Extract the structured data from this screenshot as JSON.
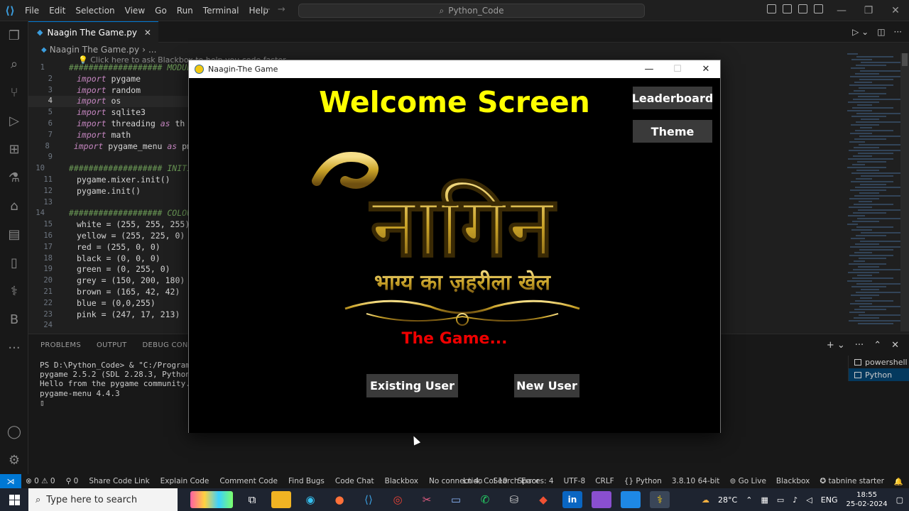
{
  "vscode": {
    "menu": [
      "File",
      "Edit",
      "Selection",
      "View",
      "Go",
      "Run",
      "Terminal",
      "Help"
    ],
    "search_label": "Python_Code",
    "tab_label": "Naagin The Game.py",
    "breadcrumb_file": "Naagin The Game.py",
    "breadcrumb_rest": "...",
    "codelens": "Click here to ask Blackbox to help you code faster",
    "code_lines": [
      {
        "n": "1",
        "parts": [
          {
            "t": "################### MODUL",
            "c": "cm"
          }
        ]
      },
      {
        "n": "2",
        "parts": [
          {
            "t": "import",
            "c": "kw"
          },
          {
            "t": " pygame",
            "c": ""
          }
        ]
      },
      {
        "n": "3",
        "parts": [
          {
            "t": "import",
            "c": "kw"
          },
          {
            "t": " random",
            "c": ""
          }
        ]
      },
      {
        "n": "4",
        "parts": [
          {
            "t": "import",
            "c": "kw"
          },
          {
            "t": " os",
            "c": ""
          }
        ]
      },
      {
        "n": "5",
        "parts": [
          {
            "t": "import",
            "c": "kw"
          },
          {
            "t": " sqlite3",
            "c": ""
          }
        ]
      },
      {
        "n": "6",
        "parts": [
          {
            "t": "import",
            "c": "kw"
          },
          {
            "t": " threading ",
            "c": ""
          },
          {
            "t": "as",
            "c": "kw"
          },
          {
            "t": " th",
            "c": ""
          }
        ]
      },
      {
        "n": "7",
        "parts": [
          {
            "t": "import",
            "c": "kw"
          },
          {
            "t": " math",
            "c": ""
          }
        ]
      },
      {
        "n": "8",
        "parts": [
          {
            "t": "import",
            "c": "kw"
          },
          {
            "t": " pygame_menu ",
            "c": ""
          },
          {
            "t": "as",
            "c": "kw"
          },
          {
            "t": " pm",
            "c": ""
          }
        ]
      },
      {
        "n": "9",
        "parts": [
          {
            "t": "",
            "c": ""
          }
        ]
      },
      {
        "n": "10",
        "parts": [
          {
            "t": "################### INITI",
            "c": "cm"
          }
        ]
      },
      {
        "n": "11",
        "parts": [
          {
            "t": "pygame.mixer.init()",
            "c": ""
          }
        ]
      },
      {
        "n": "12",
        "parts": [
          {
            "t": "pygame.init()",
            "c": ""
          }
        ]
      },
      {
        "n": "13",
        "parts": [
          {
            "t": "",
            "c": ""
          }
        ]
      },
      {
        "n": "14",
        "parts": [
          {
            "t": "################### COLOU",
            "c": "cm"
          }
        ]
      },
      {
        "n": "15",
        "parts": [
          {
            "t": "white = (255, 255, 255)",
            "c": ""
          }
        ]
      },
      {
        "n": "16",
        "parts": [
          {
            "t": "yellow = (255, 225, 0)",
            "c": ""
          }
        ]
      },
      {
        "n": "17",
        "parts": [
          {
            "t": "red = (255, 0, 0)",
            "c": ""
          }
        ]
      },
      {
        "n": "18",
        "parts": [
          {
            "t": "black = (0, 0, 0)",
            "c": ""
          }
        ]
      },
      {
        "n": "19",
        "parts": [
          {
            "t": "green = (0, 255, 0)",
            "c": ""
          }
        ]
      },
      {
        "n": "20",
        "parts": [
          {
            "t": "grey = (150, 200, 180)",
            "c": ""
          }
        ]
      },
      {
        "n": "21",
        "parts": [
          {
            "t": "brown = (165, 42, 42)",
            "c": ""
          }
        ]
      },
      {
        "n": "22",
        "parts": [
          {
            "t": "blue = (0,0,255)",
            "c": ""
          }
        ]
      },
      {
        "n": "23",
        "parts": [
          {
            "t": "pink = (247, 17, 213)",
            "c": ""
          }
        ]
      },
      {
        "n": "24",
        "parts": [
          {
            "t": "",
            "c": ""
          }
        ]
      }
    ],
    "active_line": "4",
    "panel_tabs": [
      "PROBLEMS",
      "OUTPUT",
      "DEBUG CONSOLE"
    ],
    "terminal_lines": [
      "PS D:\\Python_Code> & \"C:/Program Fi",
      "pygame 2.5.2 (SDL 2.28.3, Python 3.",
      "Hello from the pygame community. ht",
      "pygame-menu 4.4.3",
      "▯"
    ],
    "terminals": [
      "powershell",
      "Python"
    ],
    "status_left": [
      "⊗ 0 ⚠ 0",
      "⚲ 0",
      "Share Code Link",
      "Explain Code",
      "Comment Code",
      "Find Bugs",
      "Code Chat",
      "Blackbox",
      "No connection",
      "Search Error"
    ],
    "status_right": [
      "Ln 4, Col 10",
      "Spaces: 4",
      "UTF-8",
      "CRLF",
      "{} Python",
      "3.8.10 64-bit",
      "⊚ Go Live",
      "Blackbox",
      "✪ tabnine starter"
    ]
  },
  "game": {
    "window_title": "Naagin-The Game",
    "heading": "Welcome Screen",
    "leaderboard_label": "Leaderboard",
    "theme_label": "Theme",
    "logo_text": "नागिन",
    "logo_subtitle": "भाग्य का ज़हरीला खेल",
    "subtitle": "The Game...",
    "existing_user_label": "Existing User",
    "new_user_label": "New User",
    "colors": {
      "heading": "#ffff00",
      "subtitle": "#ee0000",
      "button_bg": "#3a3a3a",
      "logo_gold": "#c9a227"
    }
  },
  "taskbar": {
    "search_placeholder": "Type here to search",
    "weather": "28°C",
    "lang": "ENG",
    "time": "18:55",
    "date": "25-02-2024"
  }
}
